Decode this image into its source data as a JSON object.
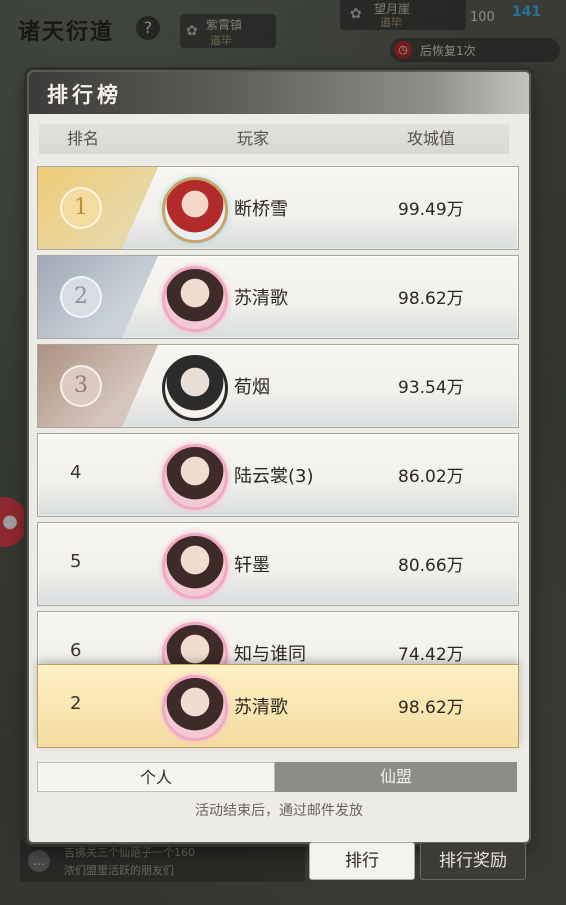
{
  "top": {
    "game_title": "诸天衍道",
    "help": "?",
    "town": {
      "name": "紫霄镇",
      "status": "道毕",
      "icon": "swirl-icon"
    },
    "moon": {
      "name": "望月崖",
      "status": "道毕",
      "icon": "swirl-icon"
    },
    "stamina": "100",
    "fps": "141",
    "recover_text": "后恢复1次"
  },
  "panel": {
    "title": "排行榜",
    "headers": {
      "rank": "排名",
      "player": "玩家",
      "score": "攻城值"
    }
  },
  "rows": [
    {
      "rank": "1",
      "name": "断桥雪",
      "score": "99.49万"
    },
    {
      "rank": "2",
      "name": "苏清歌",
      "score": "98.62万"
    },
    {
      "rank": "3",
      "name": "荀烟",
      "score": "93.54万"
    },
    {
      "rank": "4",
      "name": "陆云裳(3)",
      "score": "86.02万"
    },
    {
      "rank": "5",
      "name": "轩墨",
      "score": "80.66万"
    },
    {
      "rank": "6",
      "name": "知与谁同",
      "score": "74.42万"
    }
  ],
  "my_row": {
    "rank": "2",
    "name": "苏清歌",
    "score": "98.62万"
  },
  "tabs": {
    "personal": "个人",
    "guild": "仙盟"
  },
  "note": "活动结束后，通过邮件发放",
  "buttons": {
    "rank": "排行",
    "reward": "排行奖励"
  },
  "chat": {
    "line1": "吉拂关三个仙葩子一个160",
    "line2": "浓们盟里活跃的朋友们"
  },
  "colors": {
    "gold": "#f0cc76",
    "silver": "#9ea8b6",
    "bronze": "#ad9282",
    "highlight": "#f4dca0",
    "fps": "#3bb7f0"
  }
}
